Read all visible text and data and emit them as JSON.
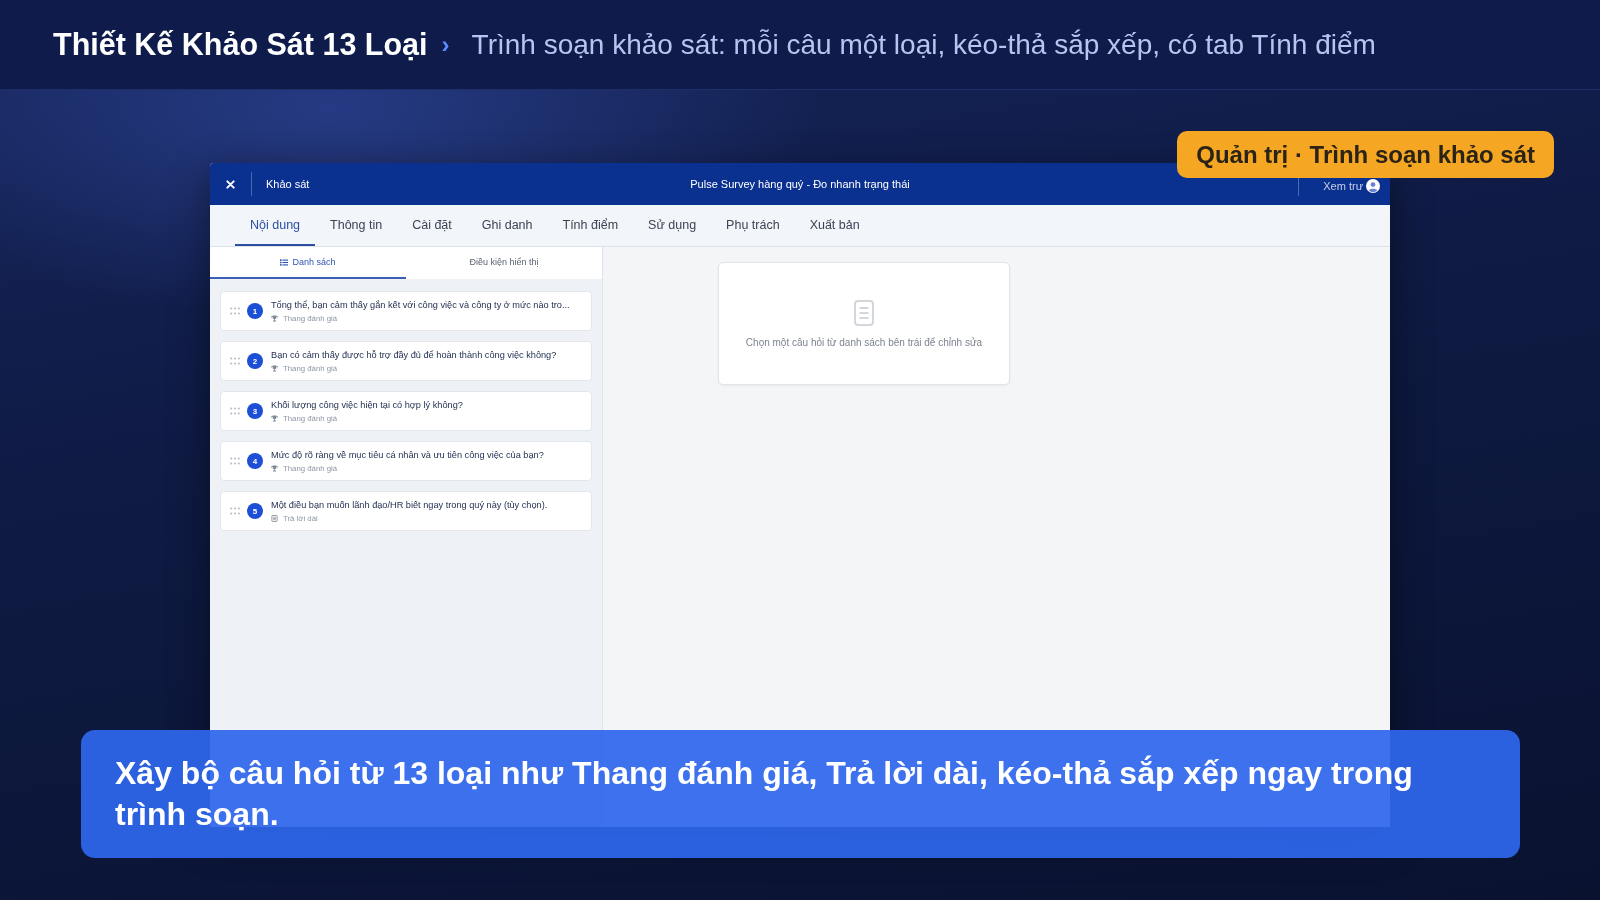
{
  "header": {
    "title": "Thiết Kế Khảo Sát 13 Loại",
    "separator": "›",
    "subtitle": "Trình soạn khảo sát: mỗi câu một loại, kéo-thả sắp xếp, có tab Tính điểm"
  },
  "badge": {
    "text": "Quản trị · Trình soạn khảo sát"
  },
  "window": {
    "section": "Khảo sát",
    "title": "Pulse Survey hàng quý - Đo nhanh trạng thái",
    "preview": "Xem trư"
  },
  "tabs": [
    {
      "label": "Nội dung",
      "selected": true
    },
    {
      "label": "Thông tin",
      "selected": false
    },
    {
      "label": "Cài đặt",
      "selected": false
    },
    {
      "label": "Ghi danh",
      "selected": false
    },
    {
      "label": "Tính điểm",
      "selected": false
    },
    {
      "label": "Sử dụng",
      "selected": false
    },
    {
      "label": "Phụ trách",
      "selected": false
    },
    {
      "label": "Xuất bản",
      "selected": false
    }
  ],
  "sub_tabs": [
    {
      "label": "Danh sách",
      "selected": true
    },
    {
      "label": "Điều kiện hiển thị",
      "selected": false
    }
  ],
  "questions": [
    {
      "number": "1",
      "text": "Tổng thể, bạn cảm thấy gắn kết với công việc và công ty ở mức nào tro...",
      "type": "Thang đánh giá",
      "kind": "rating"
    },
    {
      "number": "2",
      "text": "Bạn có cảm thấy được hỗ trợ đầy đủ để hoàn thành công việc không?",
      "type": "Thang đánh giá",
      "kind": "rating"
    },
    {
      "number": "3",
      "text": "Khối lượng công việc hiện tại có hợp lý không?",
      "type": "Thang đánh giá",
      "kind": "rating"
    },
    {
      "number": "4",
      "text": "Mức độ rõ ràng về mục tiêu cá nhân và ưu tiên công việc của bạn?",
      "type": "Thang đánh giá",
      "kind": "rating"
    },
    {
      "number": "5",
      "text": "Một điều bạn muốn lãnh đạo/HR biết ngay trong quý này (tùy chọn).",
      "type": "Trả lời dài",
      "kind": "long_text"
    }
  ],
  "editor": {
    "empty_message": "Chọn một câu hỏi từ danh sách bên trái để chỉnh sửa"
  },
  "caption": {
    "text": "Xây bộ câu hỏi từ 13 loại như Thang đánh giá, Trả lời dài, kéo-thả sắp xếp ngay trong trình soạn."
  }
}
